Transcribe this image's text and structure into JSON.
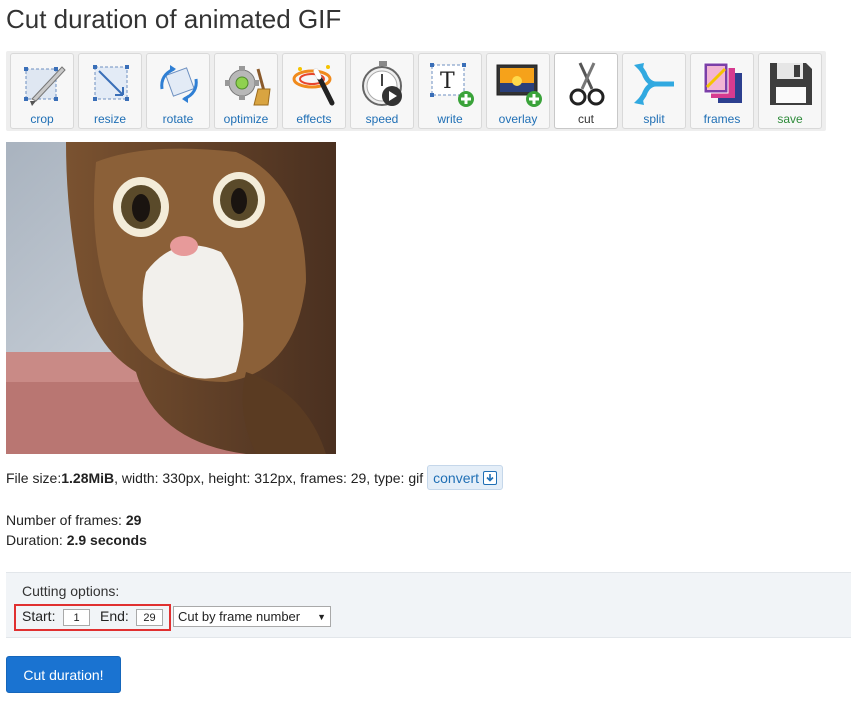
{
  "page": {
    "title": "Cut duration of animated GIF"
  },
  "toolbar": {
    "items": [
      {
        "label": "crop",
        "icon": "crop-knife-icon"
      },
      {
        "label": "resize",
        "icon": "resize-icon"
      },
      {
        "label": "rotate",
        "icon": "rotate-icon"
      },
      {
        "label": "optimize",
        "icon": "optimize-broom-icon"
      },
      {
        "label": "effects",
        "icon": "magic-wand-icon"
      },
      {
        "label": "speed",
        "icon": "stopwatch-play-icon"
      },
      {
        "label": "write",
        "icon": "text-add-icon"
      },
      {
        "label": "overlay",
        "icon": "image-add-icon"
      },
      {
        "label": "cut",
        "icon": "scissors-icon"
      },
      {
        "label": "split",
        "icon": "split-arrows-icon"
      },
      {
        "label": "frames",
        "icon": "frames-stack-icon"
      },
      {
        "label": "save",
        "icon": "floppy-disk-icon"
      }
    ],
    "active": "cut"
  },
  "file_info": {
    "size_label": "File size: ",
    "size_value": "1.28MiB",
    "rest": ", width: 330px, height: 312px, frames: 29, type: gif",
    "convert_label": "convert"
  },
  "stats": {
    "frames_label": "Number of frames: ",
    "frames_value": "29",
    "duration_label": "Duration: ",
    "duration_value": "2.9 seconds"
  },
  "cutting": {
    "title": "Cutting options:",
    "start_label": "Start:",
    "start_value": "1",
    "end_label": "End:",
    "end_value": "29",
    "mode_selected": "Cut by frame number"
  },
  "submit": {
    "label": "Cut duration!"
  },
  "colors": {
    "accent": "#1a73d1",
    "link": "#1f6fb5",
    "highlight": "#e03030"
  }
}
